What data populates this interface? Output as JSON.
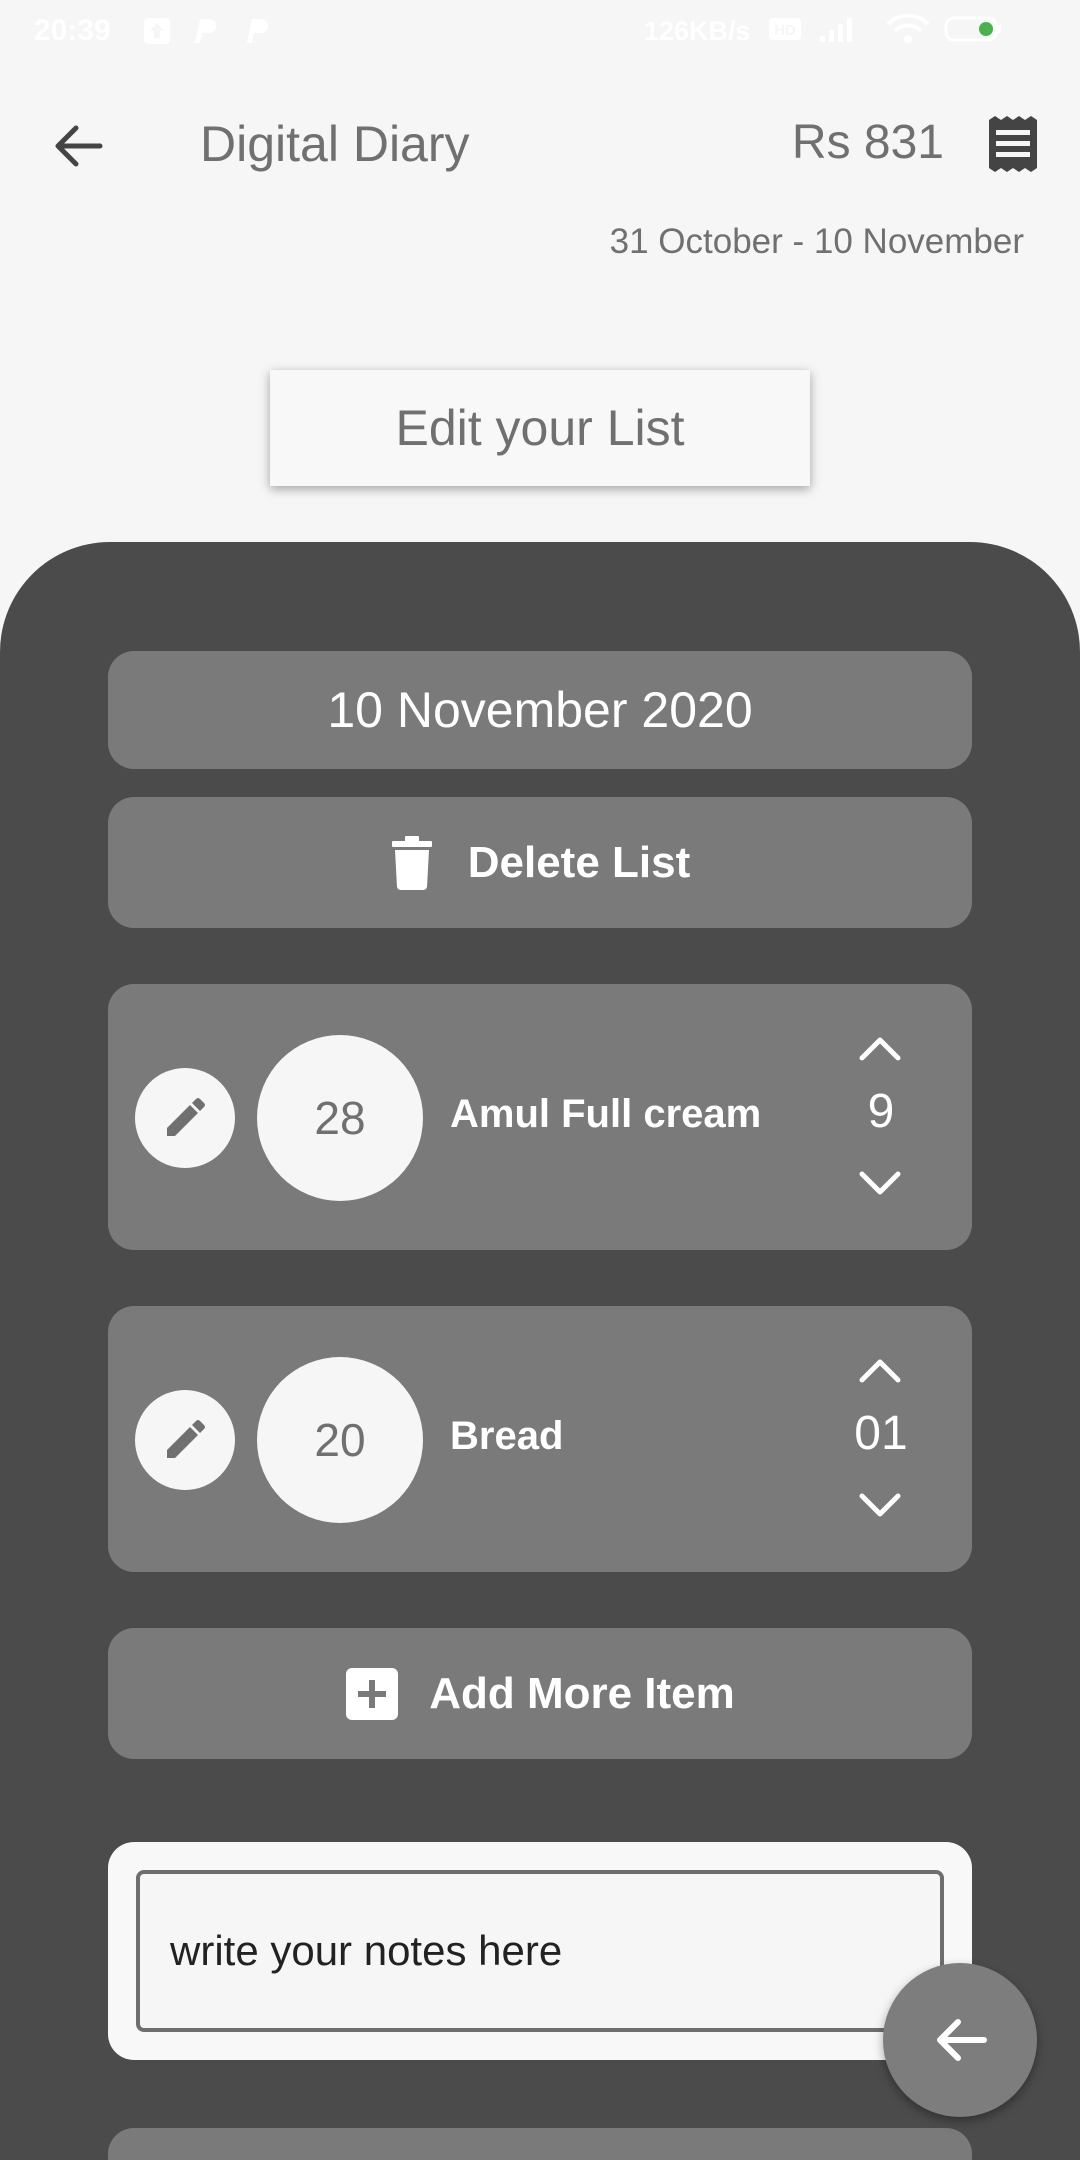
{
  "status_bar": {
    "time": "20:39",
    "network_speed": "126KB/s"
  },
  "app_bar": {
    "title": "Digital Diary",
    "total": "Rs 831"
  },
  "date_range": "31 October - 10 November",
  "edit_list_label": "Edit your List",
  "list": {
    "date": "10 November 2020",
    "delete_label": "Delete List",
    "items": [
      {
        "price": "28",
        "name": "Amul Full cream",
        "quantity": "9"
      },
      {
        "price": "20",
        "name": "Bread",
        "quantity": "01"
      }
    ],
    "add_label": "Add More Item"
  },
  "notes": {
    "value": "write your notes here"
  },
  "icons": [
    "back-arrow-icon",
    "receipt-icon",
    "trash-icon",
    "pencil-icon",
    "chevron-up-icon",
    "chevron-down-icon",
    "plus-box-icon",
    "arrow-left-icon"
  ]
}
